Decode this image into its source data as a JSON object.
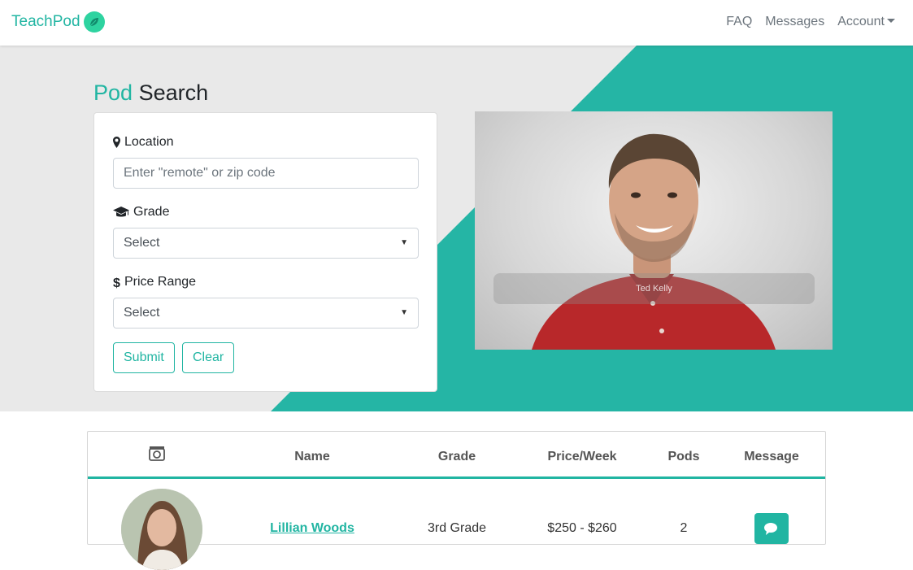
{
  "nav": {
    "brand": "TeachPod",
    "links": [
      {
        "label": "FAQ"
      },
      {
        "label": "Messages"
      },
      {
        "label": "Account"
      }
    ]
  },
  "hero": {
    "title_accent": "Pod",
    "title_rest": "Search"
  },
  "search": {
    "location_label": "Location",
    "location_placeholder": "Enter \"remote\" or zip code",
    "grade_label": "Grade",
    "grade_selected": "Select",
    "price_label": "Price Range",
    "price_selected": "Select",
    "submit_label": "Submit",
    "clear_label": "Clear"
  },
  "featured": {
    "caption": "Ted Kelly"
  },
  "table": {
    "headers": [
      "Name",
      "Grade",
      "Price/Week",
      "Pods",
      "Message"
    ],
    "rows": [
      {
        "name": "Lillian Woods",
        "grade": "3rd Grade",
        "price": "$250 - $260",
        "pods": "2"
      }
    ]
  },
  "colors": {
    "accent": "#21b5a2",
    "hero_bg": "#e9e9e9"
  },
  "icons": [
    "leaf-icon",
    "map-marker-icon",
    "graduation-cap-icon",
    "dollar-icon",
    "camera-icon",
    "comments-icon",
    "caret-down-icon"
  ]
}
